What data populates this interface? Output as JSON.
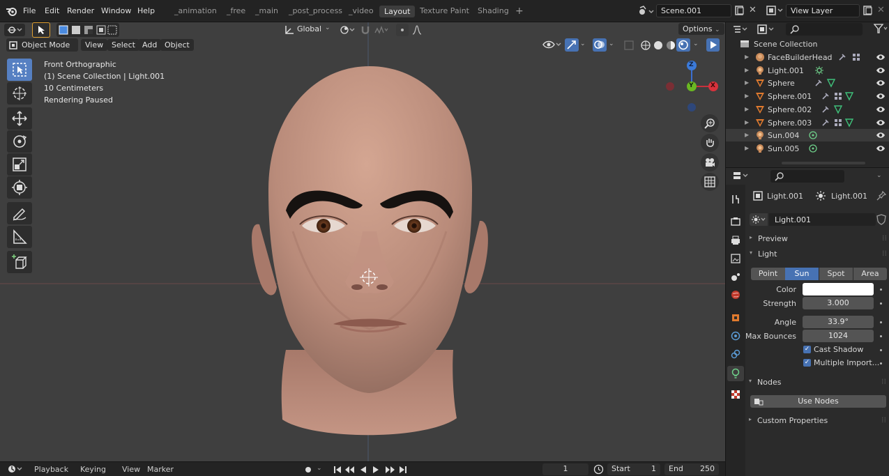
{
  "topbar": {
    "menus": [
      "File",
      "Edit",
      "Render",
      "Window",
      "Help"
    ],
    "workspaces": [
      "_animation",
      "_free",
      "_main",
      "_post_process",
      "_video",
      "Layout",
      "Texture Paint",
      "Shading"
    ],
    "active_workspace": "Layout",
    "scene": "Scene.001",
    "view_layer": "View Layer"
  },
  "viewport_header": {
    "orientation": "Global",
    "options": "Options",
    "mode": "Object Mode",
    "menus": [
      "View",
      "Select",
      "Add",
      "Object"
    ]
  },
  "overlay": {
    "view_name": "Front Orthographic",
    "collection": "(1) Scene Collection | Light.001",
    "scale": "10 Centimeters",
    "render_status": "Rendering Paused"
  },
  "gizmo": {
    "z": "Z",
    "y": "Y",
    "x": "X"
  },
  "timeline": {
    "menus": [
      "Playback",
      "Keying",
      "View",
      "Marker"
    ],
    "current_frame": "1",
    "start_label": "Start",
    "start": "1",
    "end_label": "End",
    "end": "250"
  },
  "outliner": {
    "root": "Scene Collection",
    "items": [
      {
        "name": "FaceBuilderHead",
        "icon": "empty-icon"
      },
      {
        "name": "Light.001",
        "icon": "light-icon"
      },
      {
        "name": "Sphere",
        "icon": "mesh-icon"
      },
      {
        "name": "Sphere.001",
        "icon": "mesh-icon"
      },
      {
        "name": "Sphere.002",
        "icon": "mesh-icon"
      },
      {
        "name": "Sphere.003",
        "icon": "mesh-icon"
      },
      {
        "name": "Sun.004",
        "icon": "light-icon"
      },
      {
        "name": "Sun.005",
        "icon": "light-icon"
      }
    ],
    "selected": "Sun.004"
  },
  "properties": {
    "object_name": "Light.001",
    "data_name": "Light.001",
    "datablock": "Light.001",
    "sections": {
      "preview": "Preview",
      "light": "Light",
      "nodes": "Nodes",
      "custom": "Custom Properties"
    },
    "light_types": [
      "Point",
      "Sun",
      "Spot",
      "Area"
    ],
    "active_light_type": "Sun",
    "fields": {
      "color_label": "Color",
      "color_value": "#ffffff",
      "strength_label": "Strength",
      "strength": "3.000",
      "angle_label": "Angle",
      "angle": "33.9°",
      "bounces_label": "Max Bounces",
      "bounces": "1024",
      "cast_shadow": "Cast Shadow",
      "multiple_importance": "Multiple Import..."
    },
    "use_nodes": "Use Nodes"
  }
}
